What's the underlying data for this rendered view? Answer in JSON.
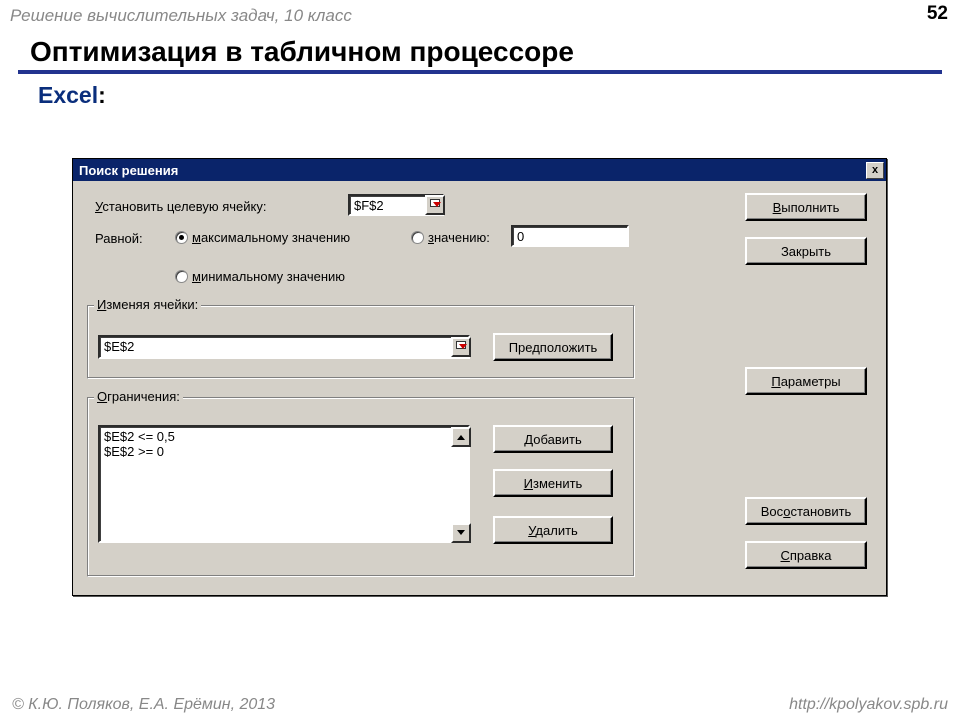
{
  "slide": {
    "header": "Решение  вычислительных задач, 10 класс",
    "page_num": "52",
    "title": "Оптимизация в табличном процессоре",
    "subtitle_app": "Excel",
    "subtitle_colon": ":"
  },
  "dialog": {
    "title": "Поиск решения",
    "close_x": "x",
    "target_label": "Установить целевую ячейку:",
    "target_value": "$F$2",
    "equal_label": "Равной:",
    "radio_max": "максимальному значению",
    "radio_min": "минимальному значению",
    "radio_val": "значению:",
    "value_input": "0",
    "changing_legend": "Изменяя ячейки:",
    "changing_value": "$E$2",
    "suggest_btn": "Предположить",
    "constraints_legend": "Ограничения:",
    "constraints": [
      "$E$2 <= 0,5",
      "$E$2 >= 0"
    ],
    "btn_add": "Добавить",
    "btn_change": "Изменить",
    "btn_delete": "Удалить",
    "btn_run": "Выполнить",
    "btn_close": "Закрыть",
    "btn_params": "Параметры",
    "btn_restore": "Восстановить",
    "btn_help": "Справка"
  },
  "footer": {
    "left": "© К.Ю. Поляков, Е.А. Ерёмин, 2013",
    "right": "http://kpolyakov.spb.ru"
  },
  "hotkeys": {
    "target_u": "У",
    "max_u": "м",
    "min_u": "м",
    "val_u": "з",
    "izm_u": "И",
    "ogr_u": "О",
    "run_u": "В",
    "params_u": "П",
    "restore_u": "о",
    "help_u": "С",
    "add_u": "Д",
    "change_u": "И",
    "del_u": "У"
  }
}
